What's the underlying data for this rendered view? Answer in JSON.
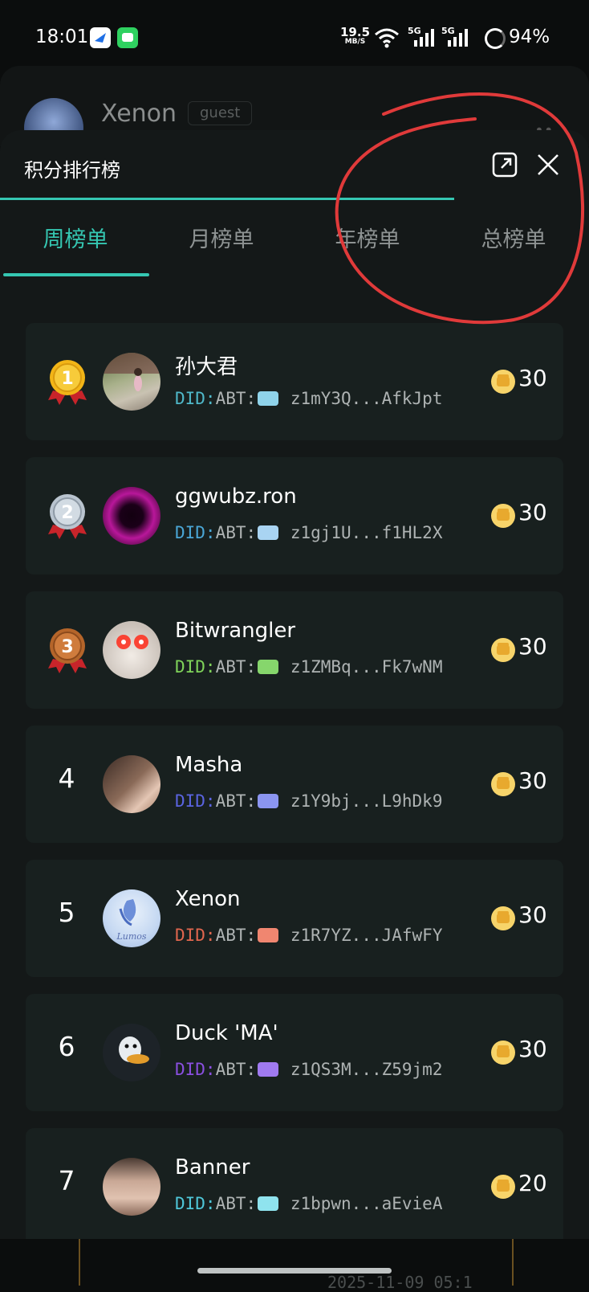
{
  "status": {
    "time": "18:01",
    "net_speed": "19.5",
    "net_unit": "MB/S",
    "signal_1": "5G",
    "signal_2": "5G",
    "battery": "94%"
  },
  "background": {
    "name": "Xenon",
    "role": "guest"
  },
  "sheet": {
    "title": "积分排行榜",
    "tabs": [
      "周榜单",
      "月榜单",
      "年榜单",
      "总榜单"
    ],
    "active_tab": 0,
    "did_prefix": "DID:",
    "did_method": "ABT:"
  },
  "leaderboard": [
    {
      "rank": "1",
      "name": "孙大君",
      "did": "z1mY3Q...AfkJpt",
      "score": "30",
      "prefix_color": "#4fb8c9",
      "badge_color": "#8fd3ea"
    },
    {
      "rank": "2",
      "name": "ggwubz.ron",
      "did": "z1gj1U...f1HL2X",
      "score": "30",
      "prefix_color": "#4aa6d6",
      "badge_color": "#a9d4f2"
    },
    {
      "rank": "3",
      "name": "Bitwrangler",
      "did": "z1ZMBq...Fk7wNM",
      "score": "30",
      "prefix_color": "#7fd35a",
      "badge_color": "#86d66c"
    },
    {
      "rank": "4",
      "name": "Masha",
      "did": "z1Y9bj...L9hDk9",
      "score": "30",
      "prefix_color": "#5a64e0",
      "badge_color": "#8b95f0"
    },
    {
      "rank": "5",
      "name": "Xenon",
      "did": "z1R7YZ...JAfwFY",
      "score": "30",
      "prefix_color": "#e0664e",
      "badge_color": "#f08670"
    },
    {
      "rank": "6",
      "name": "Duck 'MA'",
      "did": "z1QS3M...Z59jm2",
      "score": "30",
      "prefix_color": "#8a4fe0",
      "badge_color": "#a07af0"
    },
    {
      "rank": "7",
      "name": "Banner",
      "did": "z1bpwn...aEvieA",
      "score": "20",
      "prefix_color": "#4fc7d9",
      "badge_color": "#8fe3ee"
    }
  ],
  "footer": {
    "date": "2025-11-09 05:1"
  }
}
